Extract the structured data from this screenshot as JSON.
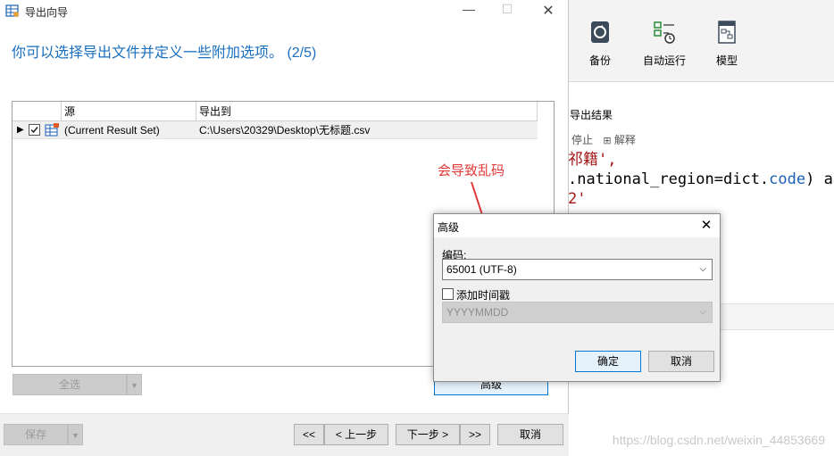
{
  "wizard": {
    "title": "导出向导",
    "heading": "你可以选择导出文件并定义一些附加选项。 (2/5)",
    "grid": {
      "columns": [
        "源",
        "导出到"
      ],
      "rows": [
        {
          "source": "(Current Result Set)",
          "target": "C:\\Users\\20329\\Desktop\\无标题.csv",
          "checked": true
        }
      ]
    },
    "buttons": {
      "select_all": "全选",
      "advanced": "高级",
      "save": "保存",
      "first": "<<",
      "prev": "< 上一步",
      "next": "下一步 >",
      "last": ">>",
      "cancel": "取消"
    }
  },
  "annotation": "会导致乱码",
  "dialog": {
    "title": "高级",
    "encoding_label": "编码:",
    "encoding_value": "65001 (UTF-8)",
    "timestamp_label": "添加时间戳",
    "timestamp_checked": false,
    "timestamp_format": "YYYYMMDD",
    "ok": "确定",
    "cancel": "取消"
  },
  "background": {
    "toolbar": [
      "备份",
      "自动运行",
      "模型"
    ],
    "result_title": "导出结果",
    "actions": [
      "停止",
      "解释"
    ],
    "code_lines": {
      "l1": "祁籍',",
      "l2a": ".national_region=dict.",
      "l2b": "code",
      "l2c": ") as",
      "l3": "2'"
    },
    "watermark": "https://blog.csdn.net/weixin_44853669"
  },
  "colors": {
    "heading": "#1a6fbf",
    "annotation": "#e23838",
    "focus": "#0078d7"
  }
}
